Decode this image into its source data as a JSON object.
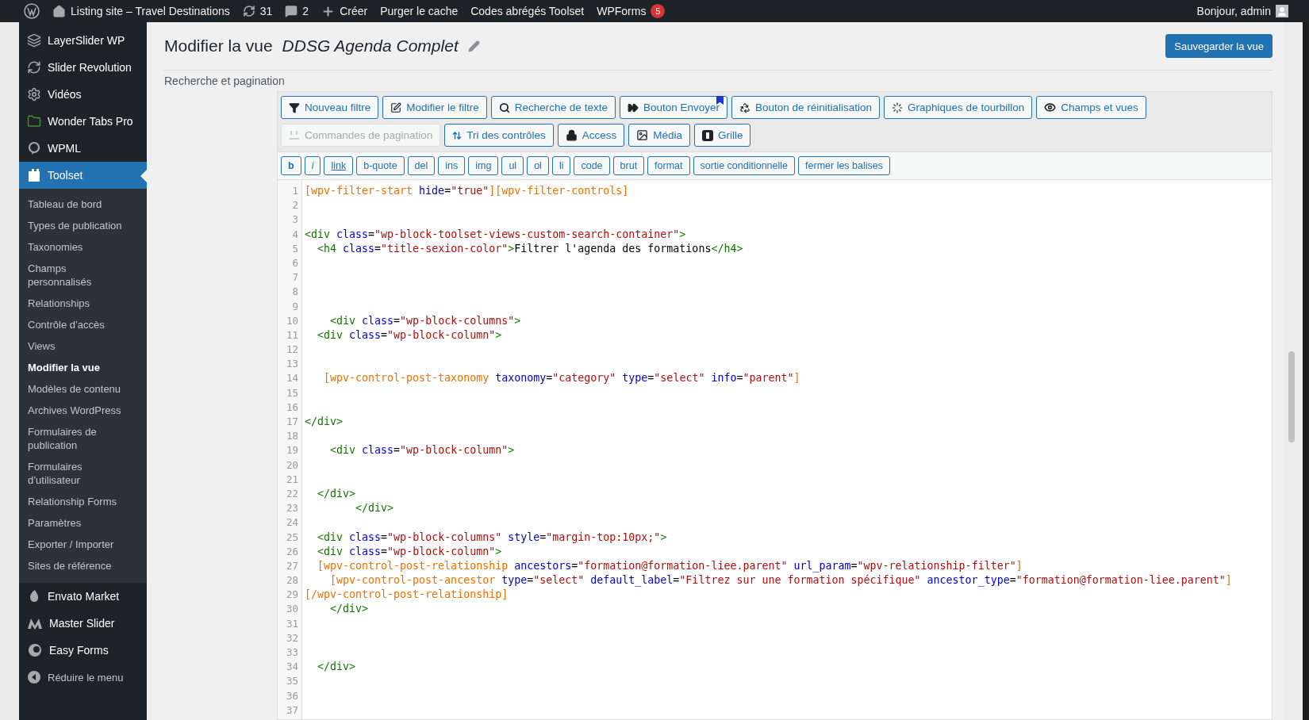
{
  "admin_bar": {
    "site": "Listing site – Travel Destinations",
    "updates": "31",
    "comments": "2",
    "new_label": "Créer",
    "links": [
      "Purger le cache",
      "Codes abrégés Toolset"
    ],
    "wpforms": {
      "label": "WPForms",
      "badge": "5"
    },
    "greeting": "Bonjour, admin"
  },
  "sidebar": {
    "top_items": [
      {
        "label": "LayerSlider WP",
        "selected": false
      },
      {
        "label": "Slider Revolution",
        "selected": false
      },
      {
        "label": "Vidéos",
        "selected": false
      },
      {
        "label": "Wonder Tabs Pro",
        "selected": false
      },
      {
        "label": "WPML",
        "selected": false
      },
      {
        "label": "Toolset",
        "selected": true
      }
    ],
    "submenu": [
      {
        "label": "Tableau de bord",
        "selected": false
      },
      {
        "label": "Types de publication",
        "selected": false
      },
      {
        "label": "Taxonomies",
        "selected": false
      },
      {
        "label": "Champs personnalisés",
        "selected": false
      },
      {
        "label": "Relationships",
        "selected": false
      },
      {
        "label": "Contrôle d’accès",
        "selected": false
      },
      {
        "label": "Views",
        "selected": false
      },
      {
        "label": "Modifier la vue",
        "selected": true
      },
      {
        "label": "Modèles de contenu",
        "selected": false
      },
      {
        "label": "Archives WordPress",
        "selected": false
      },
      {
        "label": "Formulaires de publication",
        "selected": false
      },
      {
        "label": "Formulaires d’utilisateur",
        "selected": false
      },
      {
        "label": "Relationship Forms",
        "selected": false
      },
      {
        "label": "Paramètres",
        "selected": false
      },
      {
        "label": "Exporter / Importer",
        "selected": false
      },
      {
        "label": "Sites de référence",
        "selected": false
      }
    ],
    "bottom_items": [
      {
        "label": "Envato Market",
        "selected": false
      },
      {
        "label": "Master Slider",
        "selected": false
      },
      {
        "label": "Easy Forms",
        "selected": false
      }
    ],
    "collapse": "Réduire le menu"
  },
  "page": {
    "title": "Modifier la vue",
    "view_name": "DDSG Agenda Complet",
    "save_button": "Sauvegarder la vue",
    "section_heading": "Recherche et pagination"
  },
  "toolbar": {
    "rows": [
      [
        {
          "label": "Nouveau filtre",
          "disabled": false,
          "bookmarked": false
        },
        {
          "label": "Modifier le filtre",
          "disabled": false,
          "bookmarked": false
        },
        {
          "label": "Recherche de texte",
          "disabled": false,
          "bookmarked": false
        },
        {
          "label": "Bouton Envoyer",
          "disabled": false,
          "bookmarked": true
        },
        {
          "label": "Bouton de réinitialisation",
          "disabled": false,
          "bookmarked": false
        },
        {
          "label": "Graphiques de tourbillon",
          "disabled": false,
          "bookmarked": false
        },
        {
          "label": "Champs et vues",
          "disabled": false,
          "bookmarked": false
        }
      ],
      [
        {
          "label": "Commandes de pagination",
          "disabled": true,
          "bookmarked": false
        },
        {
          "label": "Tri des contrôles",
          "disabled": false,
          "bookmarked": false
        },
        {
          "label": "Access",
          "disabled": false,
          "bookmarked": false
        },
        {
          "label": "Média",
          "disabled": false,
          "bookmarked": false
        },
        {
          "label": "Grille",
          "disabled": false,
          "bookmarked": false
        }
      ]
    ],
    "format_buttons": [
      {
        "label": "b",
        "kind": "bold"
      },
      {
        "label": "i",
        "kind": "italic"
      },
      {
        "label": "link",
        "kind": "link"
      },
      {
        "label": "b-quote",
        "kind": "plain"
      },
      {
        "label": "del",
        "kind": "plain"
      },
      {
        "label": "ins",
        "kind": "plain"
      },
      {
        "label": "img",
        "kind": "plain"
      },
      {
        "label": "ul",
        "kind": "plain"
      },
      {
        "label": "ol",
        "kind": "plain"
      },
      {
        "label": "li",
        "kind": "plain"
      },
      {
        "label": "code",
        "kind": "plain"
      },
      {
        "label": "brut",
        "kind": "plain"
      },
      {
        "label": "format",
        "kind": "plain"
      },
      {
        "label": "sortie conditionnelle",
        "kind": "plain"
      },
      {
        "label": "fermer les balises",
        "kind": "plain"
      }
    ]
  },
  "editor": {
    "lines": [
      {
        "number": "1",
        "tokens": [
          {
            "kind": "shortcode",
            "text": "[wpv-filter-start"
          },
          {
            "kind": "attr",
            "text": " hide"
          },
          {
            "kind": "plain",
            "text": "="
          },
          {
            "kind": "string",
            "text": "\"true\""
          },
          {
            "kind": "shortcode",
            "text": "][wpv-filter-controls]"
          }
        ]
      },
      {
        "number": "2"
      },
      {
        "number": "3"
      },
      {
        "number": "4",
        "tokens": [
          {
            "kind": "tag",
            "text": "<div"
          },
          {
            "kind": "attr",
            "text": " class"
          },
          {
            "kind": "plain",
            "text": "="
          },
          {
            "kind": "string",
            "text": "\"wp-block-toolset-views-custom-search-container\""
          },
          {
            "kind": "tag",
            "text": ">"
          }
        ]
      },
      {
        "number": "5",
        "tokens": [
          {
            "kind": "tag",
            "text": "  <h4"
          },
          {
            "kind": "attr",
            "text": " class"
          },
          {
            "kind": "plain",
            "text": "="
          },
          {
            "kind": "string",
            "text": "\"title-sexion-color\""
          },
          {
            "kind": "tag",
            "text": ">"
          },
          {
            "kind": "plain",
            "text": "Filtrer l'agenda des formations"
          },
          {
            "kind": "tag",
            "text": "</h4>"
          }
        ]
      },
      {
        "number": "6"
      },
      {
        "number": "7"
      },
      {
        "number": "8"
      },
      {
        "number": "9"
      },
      {
        "number": "10",
        "tokens": [
          {
            "kind": "tag",
            "text": "    <div"
          },
          {
            "kind": "attr",
            "text": " class"
          },
          {
            "kind": "plain",
            "text": "="
          },
          {
            "kind": "string",
            "text": "\"wp-block-columns\""
          },
          {
            "kind": "tag",
            "text": ">"
          }
        ]
      },
      {
        "number": "11",
        "tokens": [
          {
            "kind": "tag",
            "text": "  <div"
          },
          {
            "kind": "attr",
            "text": " class"
          },
          {
            "kind": "plain",
            "text": "="
          },
          {
            "kind": "string",
            "text": "\"wp-block-column\""
          },
          {
            "kind": "tag",
            "text": ">"
          }
        ]
      },
      {
        "number": "12"
      },
      {
        "number": "13"
      },
      {
        "number": "14",
        "tokens": [
          {
            "kind": "shortcode",
            "text": "   [wpv-control-post-taxonomy"
          },
          {
            "kind": "attr",
            "text": " taxonomy"
          },
          {
            "kind": "plain",
            "text": "="
          },
          {
            "kind": "string",
            "text": "\"category\""
          },
          {
            "kind": "attr",
            "text": " type"
          },
          {
            "kind": "plain",
            "text": "="
          },
          {
            "kind": "string",
            "text": "\"select\""
          },
          {
            "kind": "attr",
            "text": " info"
          },
          {
            "kind": "plain",
            "text": "="
          },
          {
            "kind": "string",
            "text": "\"parent\""
          },
          {
            "kind": "shortcode",
            "text": "]"
          }
        ]
      },
      {
        "number": "15"
      },
      {
        "number": "16"
      },
      {
        "number": "17",
        "tokens": [
          {
            "kind": "tag",
            "text": "</div>"
          }
        ]
      },
      {
        "number": "18"
      },
      {
        "number": "19",
        "tokens": [
          {
            "kind": "tag",
            "text": "    <div"
          },
          {
            "kind": "attr",
            "text": " class"
          },
          {
            "kind": "plain",
            "text": "="
          },
          {
            "kind": "string",
            "text": "\"wp-block-column\""
          },
          {
            "kind": "tag",
            "text": ">"
          }
        ]
      },
      {
        "number": "20"
      },
      {
        "number": "21"
      },
      {
        "number": "22",
        "tokens": [
          {
            "kind": "tag",
            "text": "  </div>"
          }
        ]
      },
      {
        "number": "23",
        "tokens": [
          {
            "kind": "tag",
            "text": "        </div>"
          }
        ]
      },
      {
        "number": "24"
      },
      {
        "number": "25",
        "tokens": [
          {
            "kind": "tag",
            "text": "  <div"
          },
          {
            "kind": "attr",
            "text": " class"
          },
          {
            "kind": "plain",
            "text": "="
          },
          {
            "kind": "string",
            "text": "\"wp-block-columns\""
          },
          {
            "kind": "attr",
            "text": " style"
          },
          {
            "kind": "plain",
            "text": "="
          },
          {
            "kind": "string",
            "text": "\"margin-top:10px;\""
          },
          {
            "kind": "tag",
            "text": ">"
          }
        ]
      },
      {
        "number": "26",
        "tokens": [
          {
            "kind": "tag",
            "text": "  <div"
          },
          {
            "kind": "attr",
            "text": " class"
          },
          {
            "kind": "plain",
            "text": "="
          },
          {
            "kind": "string",
            "text": "\"wp-block-column\""
          },
          {
            "kind": "tag",
            "text": ">"
          }
        ]
      },
      {
        "number": "27",
        "tokens": [
          {
            "kind": "shortcode",
            "text": "  [wpv-control-post-relationship"
          },
          {
            "kind": "attr",
            "text": " ancestors"
          },
          {
            "kind": "plain",
            "text": "="
          },
          {
            "kind": "string",
            "text": "\"formation@formation-liee.parent\""
          },
          {
            "kind": "attr",
            "text": " url_param"
          },
          {
            "kind": "plain",
            "text": "="
          },
          {
            "kind": "string",
            "text": "\"wpv-relationship-filter\""
          },
          {
            "kind": "shortcode",
            "text": "]"
          }
        ]
      },
      {
        "number": "28",
        "tokens": [
          {
            "kind": "shortcode",
            "text": "    [wpv-control-post-ancestor"
          },
          {
            "kind": "attr",
            "text": " type"
          },
          {
            "kind": "plain",
            "text": "="
          },
          {
            "kind": "string",
            "text": "\"select\""
          },
          {
            "kind": "attr",
            "text": " default_label"
          },
          {
            "kind": "plain",
            "text": "="
          },
          {
            "kind": "string",
            "text": "\"Filtrez sur une formation spécifique\""
          },
          {
            "kind": "attr",
            "text": " ancestor_type"
          },
          {
            "kind": "plain",
            "text": "="
          },
          {
            "kind": "string",
            "text": "\"formation@formation-liee.parent\""
          },
          {
            "kind": "shortcode",
            "text": "]"
          }
        ]
      },
      {
        "number": "29",
        "tokens": [
          {
            "kind": "shortcode",
            "text": "[/wpv-control-post-relationship]"
          }
        ]
      },
      {
        "number": "30",
        "tokens": [
          {
            "kind": "tag",
            "text": "    </div>"
          }
        ]
      },
      {
        "number": "31"
      },
      {
        "number": "32"
      },
      {
        "number": "33"
      },
      {
        "number": "34",
        "tokens": [
          {
            "kind": "tag",
            "text": "  </div>"
          }
        ]
      },
      {
        "number": "35"
      },
      {
        "number": "36"
      },
      {
        "number": "37"
      }
    ]
  }
}
